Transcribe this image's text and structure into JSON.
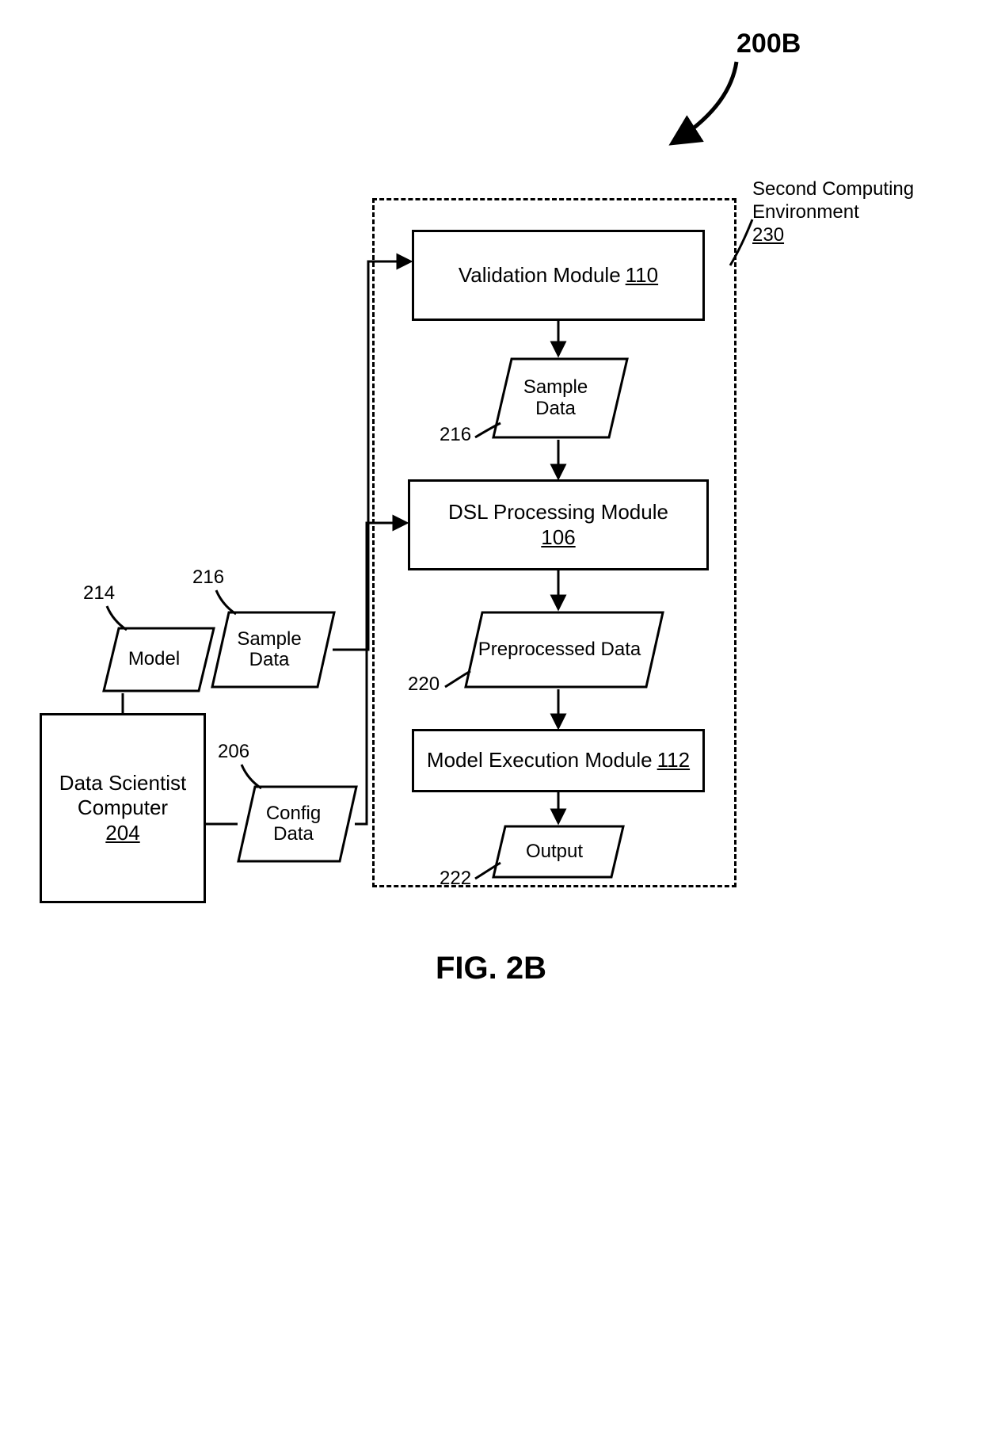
{
  "figure": {
    "ref_label": "200B",
    "caption": "FIG. 2B",
    "env_title": "Second Computing Environment",
    "env_ref": "230"
  },
  "boxes": {
    "data_scientist": {
      "label": "Data Scientist Computer",
      "ref": "204"
    },
    "validation": {
      "label": "Validation Module",
      "ref": "110"
    },
    "dsl": {
      "label": "DSL Processing Module",
      "ref": "106"
    },
    "model_exec": {
      "label": "Model Execution Module",
      "ref": "112"
    }
  },
  "paras": {
    "model": {
      "label": "Model",
      "ref": "214"
    },
    "sample_top": {
      "label": "Sample Data",
      "ref": "216"
    },
    "config": {
      "label": "Config Data",
      "ref": "206"
    },
    "sample_mid": {
      "label": "Sample Data",
      "ref": "216"
    },
    "preprocessed": {
      "label": "Preprocessed Data",
      "ref": "220"
    },
    "output": {
      "label": "Output",
      "ref": "222"
    }
  }
}
